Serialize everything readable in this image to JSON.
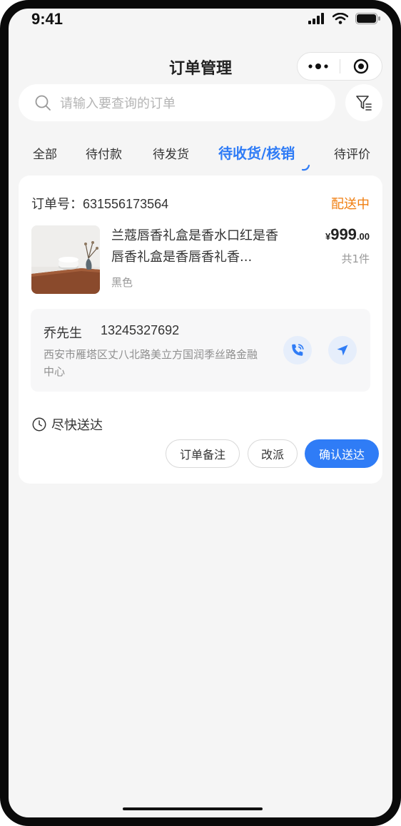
{
  "status_bar": {
    "time": "9:41"
  },
  "nav": {
    "title": "订单管理"
  },
  "search": {
    "placeholder": "请输入要查询的订单"
  },
  "tabs": [
    {
      "label": "全部"
    },
    {
      "label": "待付款"
    },
    {
      "label": "待发货"
    },
    {
      "label": "待收货/核销",
      "active": true
    },
    {
      "label": "待评价"
    }
  ],
  "order": {
    "order_no_label": "订单号：",
    "order_no": "631556173564",
    "status": "配送中",
    "product_name": "兰蔻唇香礼盒是香水口红是香唇香礼盒是香唇香礼香...",
    "variant": "黑色",
    "price_currency": "¥",
    "price_int": "999",
    "price_dec": ".00",
    "quantity": "共1件",
    "customer_name": "乔先生",
    "customer_phone": "13245327692",
    "address": "西安市雁塔区丈八北路美立方国润季丝路金融中心",
    "delivery_time": "尽快送达",
    "actions": {
      "note": "订单备注",
      "reassign": "改派",
      "confirm": "确认送达"
    }
  },
  "colors": {
    "accent": "#2f7cf6",
    "status": "#f07e0f",
    "background": "#f5f5f5"
  },
  "icons": [
    "signal-icon",
    "wifi-icon",
    "battery-icon",
    "more-icon",
    "close-target-icon",
    "search-icon",
    "filter-icon",
    "phone-icon",
    "navigate-icon",
    "clock-icon"
  ]
}
